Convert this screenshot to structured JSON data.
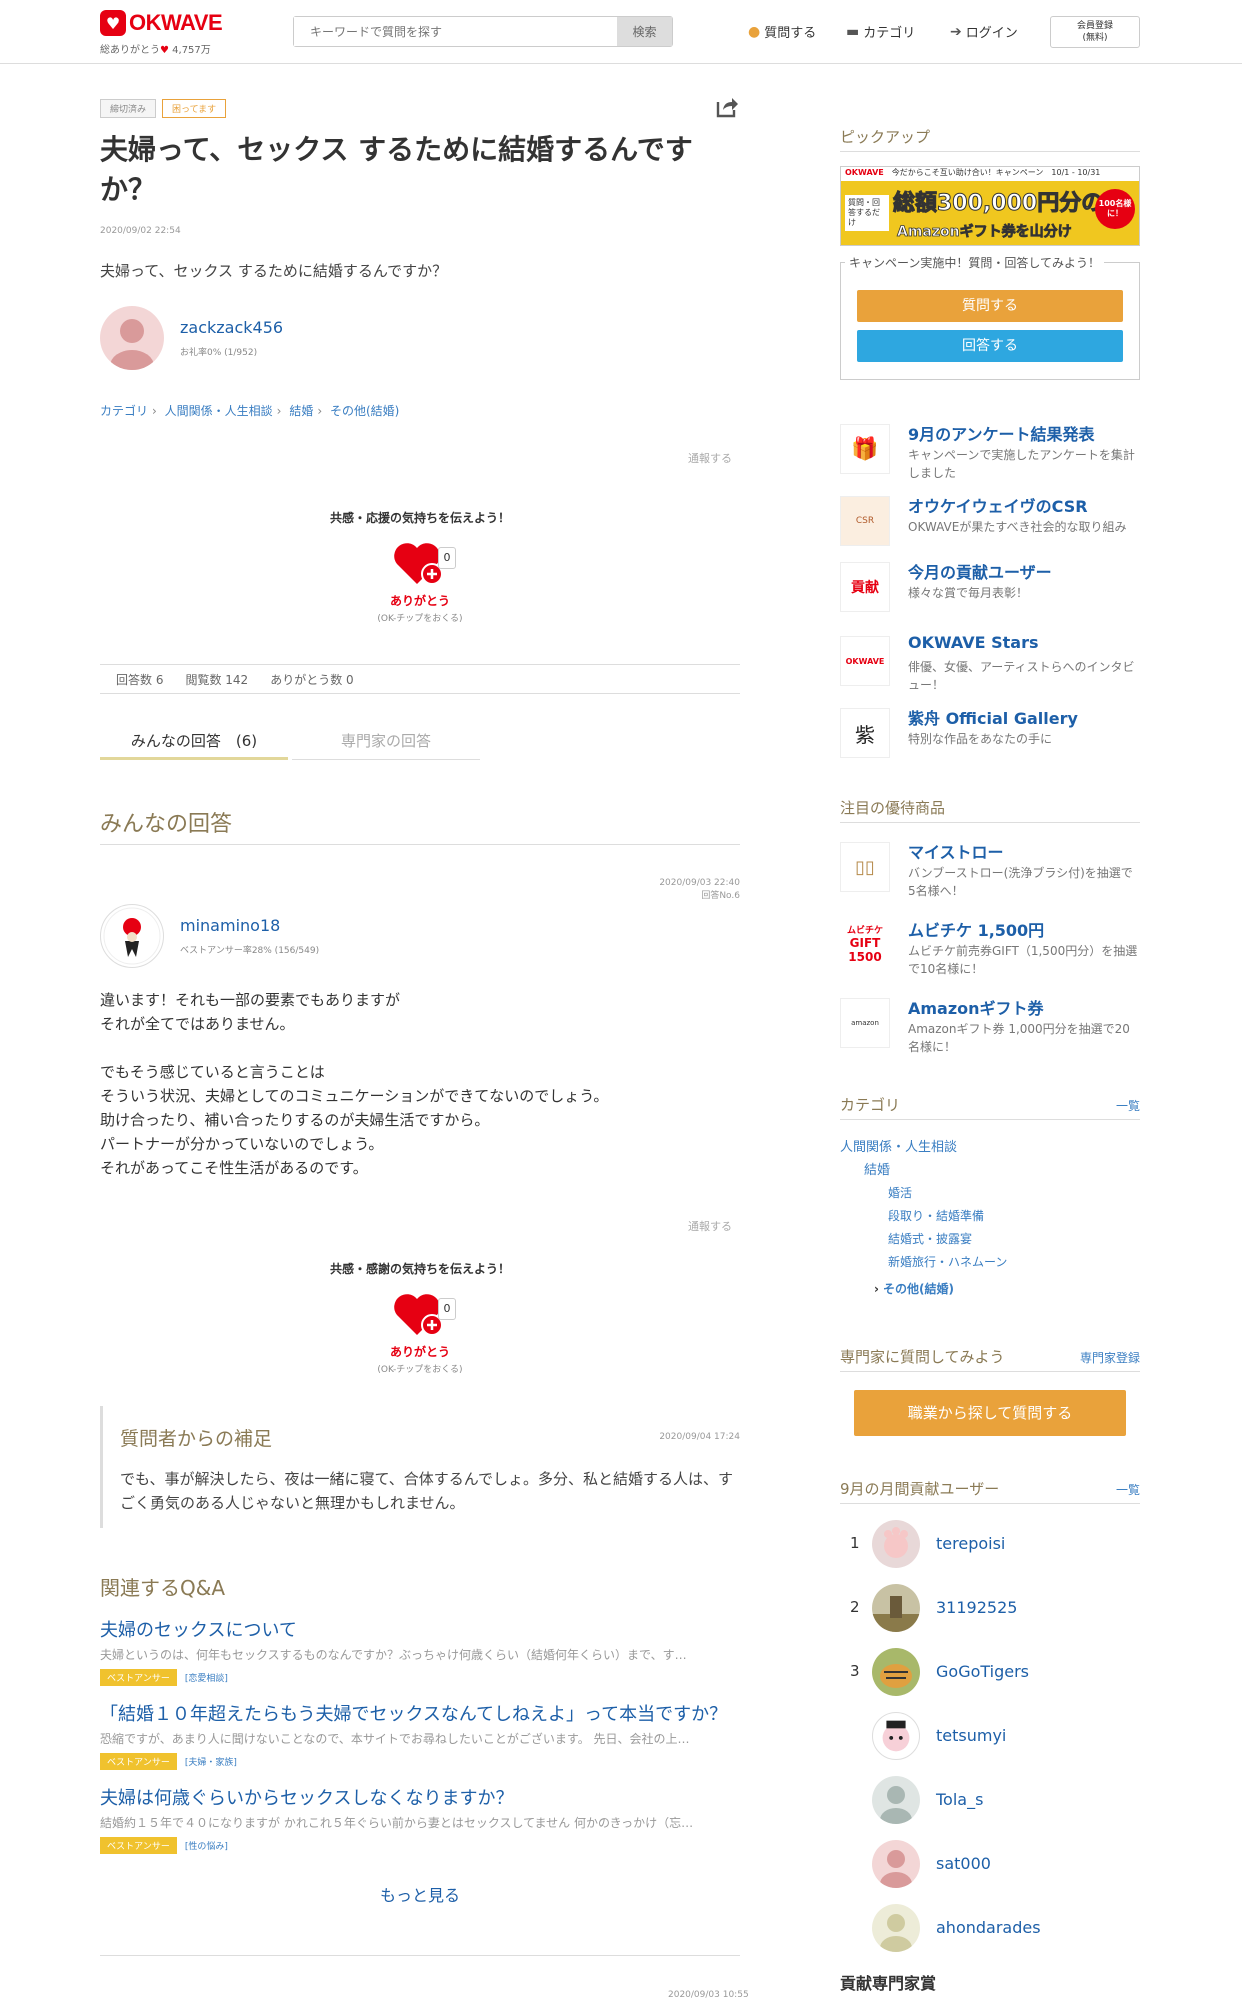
{
  "header": {
    "logo": "OKWAVE",
    "tagline_prefix": "総ありがとう",
    "tagline_count": "4,757万",
    "search_placeholder": "キーワードで質問を探す",
    "search_button": "検索",
    "nav_ask": "質問する",
    "nav_category": "カテゴリ",
    "nav_login": "ログイン",
    "register_line1": "会員登録",
    "register_line2": "(無料)"
  },
  "question": {
    "tag_closed": "締切済み",
    "tag_trouble": "困ってます",
    "title": "夫婦って、セックス するために結婚するんですか？",
    "date": "2020/09/02 22:54",
    "body": "夫婦って、セックス するために結婚するんですか？",
    "user": "zackzack456",
    "user_sub": "お礼率0% (1/952)",
    "breadcrumb": [
      "カテゴリ",
      "人間関係・人生相談",
      "結婚",
      "その他(結婚)"
    ],
    "report": "通報する",
    "thanks_prompt": "共感・応援の気持ちを伝えよう！",
    "thanks_count": "0",
    "thanks_label": "ありがとう",
    "thanks_sub": "(OK-チップをおくる)",
    "stats": [
      "回答数 6",
      "閲覧数 142",
      "ありがとう数 0"
    ]
  },
  "tabs": [
    "みんなの回答　(6)",
    "専門家の回答"
  ],
  "answers_heading": "みんなの回答",
  "answer": {
    "date": "2020/09/03 22:40",
    "no": "回答No.6",
    "user": "minamino18",
    "user_sub": "ベストアンサー率28% (156/549)",
    "body": "違います！それも一部の要素でもありますが\nそれが全てではありません。\n\nでもそう感じていると言うことは\nそういう状況、夫婦としてのコミュニケーションができてないのでしょう。\n助け合ったり、補い合ったりするのが夫婦生活ですから。\nパートナーが分かっていないのでしょう。\nそれがあってこそ性生活があるのです。",
    "report": "通報する",
    "thanks_prompt": "共感・感謝の気持ちを伝えよう！",
    "thanks_count": "0",
    "thanks_label": "ありがとう",
    "thanks_sub": "(OK-チップをおくる)"
  },
  "supplement": {
    "heading": "質問者からの補足",
    "date": "2020/09/04 17:24",
    "body": "でも、事が解決したら、夜は一緒に寝て、合体するんでしょ。多分、私と結婚する人は、すごく勇気のある人じゃないと無理かもしれません。"
  },
  "related": {
    "heading": "関連するQ&A",
    "items": [
      {
        "title": "夫婦のセックスについて",
        "snippet": "夫婦というのは、何年もセックスするものなんですか？ぶっちゃけ何歳くらい（結婚何年くらい）まで、す…",
        "badge": "ベストアンサー",
        "cat": "[恋愛相談]"
      },
      {
        "title": "「結婚１０年超えたらもう夫婦でセックスなんてしねえよ」って本当ですか？",
        "snippet": "恐縮ですが、あまり人に聞けないことなので、本サイトでお尋ねしたいことがございます。 先日、会社の上…",
        "badge": "ベストアンサー",
        "cat": "[夫婦・家族]"
      },
      {
        "title": "夫婦は何歳ぐらいからセックスしなくなりますか？",
        "snippet": "結婚約１５年で４０になりますが かれこれ５年ぐらい前から妻とはセックスしてません 何かのきっかけ（忘…",
        "badge": "ベストアンサー",
        "cat": "[性の悩み]"
      }
    ],
    "more": "もっと見る",
    "next_date": "2020/09/03 10:55"
  },
  "sidebar": {
    "pickup_heading": "ピックアップ",
    "banner_top": "今だからこそ互い助け合い！キャンペーン",
    "banner_dates": "10/1 - 10/31",
    "banner_left": "質問・回答するだけ",
    "banner_amount": "総額300,000円分の",
    "banner_bottom": "Amazonギフト券を山分け",
    "banner_badge": "100名様に！",
    "campaign_text": "キャンペーン実施中！質問・回答してみよう！",
    "btn_ask": "質問する",
    "btn_answer": "回答する",
    "picks": [
      {
        "title": "9月のアンケート結果発表",
        "desc": "キャンペーンで実施したアンケートを集計しました",
        "icon": "gift-icon"
      },
      {
        "title": "オウケイウェイヴのCSR",
        "desc": "OKWAVEが果たすべき社会的な取り組み",
        "icon": "csr-icon"
      },
      {
        "title": "今月の貢献ユーザー",
        "desc": "様々な賞で毎月表彰！",
        "icon": "award-icon"
      },
      {
        "title": "OKWAVE Stars",
        "desc": "俳優、女優、アーティストらへのインタビュー！",
        "icon": "stars-icon"
      },
      {
        "title": "紫舟 Official Gallery",
        "desc": "特別な作品をあなたの手に",
        "icon": "calligraphy-icon"
      }
    ],
    "offers_heading": "注目の優待商品",
    "offers": [
      {
        "title": "マイストロー",
        "desc": "バンブーストロー(洗浄ブラシ付)を抽選で5名様へ！"
      },
      {
        "title": "ムビチケ 1,500円",
        "desc": "ムビチケ前売券GIFT（1,500円分）を抽選で10名様に！",
        "thumb_line1": "ムビチケ",
        "thumb_line2": "GIFT",
        "thumb_line3": "1500"
      },
      {
        "title": "Amazonギフト券",
        "desc": "Amazonギフト券 1,000円分を抽選で20名様に！",
        "thumb": "amazon"
      }
    ],
    "category_heading": "カテゴリ",
    "category_link": "一覧",
    "categories": [
      "人間関係・人生相談",
      "結婚",
      "婚活",
      "段取り・結婚準備",
      "結婚式・披露宴",
      "新婚旅行・ハネムーン",
      "その他(結婚)"
    ],
    "expert_heading": "専門家に質問してみよう",
    "expert_link": "専門家登録",
    "expert_button": "職業から探して質問する",
    "rank_heading": "9月の月間貢献ユーザー",
    "rank_link": "一覧",
    "ranking": [
      {
        "n": "1",
        "name": "terepoisi"
      },
      {
        "n": "2",
        "name": "31192525"
      },
      {
        "n": "3",
        "name": "GoGoTigers"
      },
      {
        "n": "",
        "name": "tetsumyi"
      },
      {
        "n": "",
        "name": "Tola_s"
      },
      {
        "n": "",
        "name": "sat000"
      },
      {
        "n": "",
        "name": "ahondarades"
      }
    ],
    "bottom_heading": "貢献専門家賞"
  }
}
